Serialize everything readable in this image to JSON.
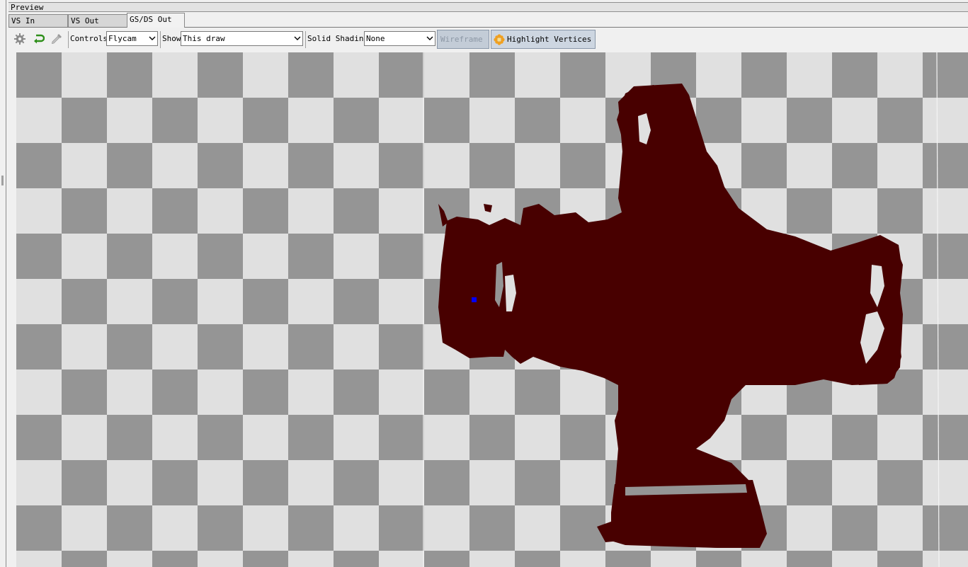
{
  "panel": {
    "title": "Preview"
  },
  "tabs": [
    {
      "label": "VS In"
    },
    {
      "label": "VS Out"
    },
    {
      "label": "GS/DS Out"
    }
  ],
  "toolbar": {
    "icons": [
      "gear-icon",
      "reset-arrow-icon",
      "eyedropper-icon"
    ],
    "controls_label": "Controls",
    "controls_value": "Flycam",
    "show_label": "Show",
    "show_value": "This draw",
    "shading_label": "Solid Shading",
    "shading_value": "None",
    "wireframe_label": "Wireframe",
    "highlight_label": "Highlight Vertices"
  },
  "colors": {
    "mesh": "#480000",
    "selected_vertex": "#0000ff",
    "checker_dark": "#959595",
    "checker_light": "#e0e0e0"
  }
}
